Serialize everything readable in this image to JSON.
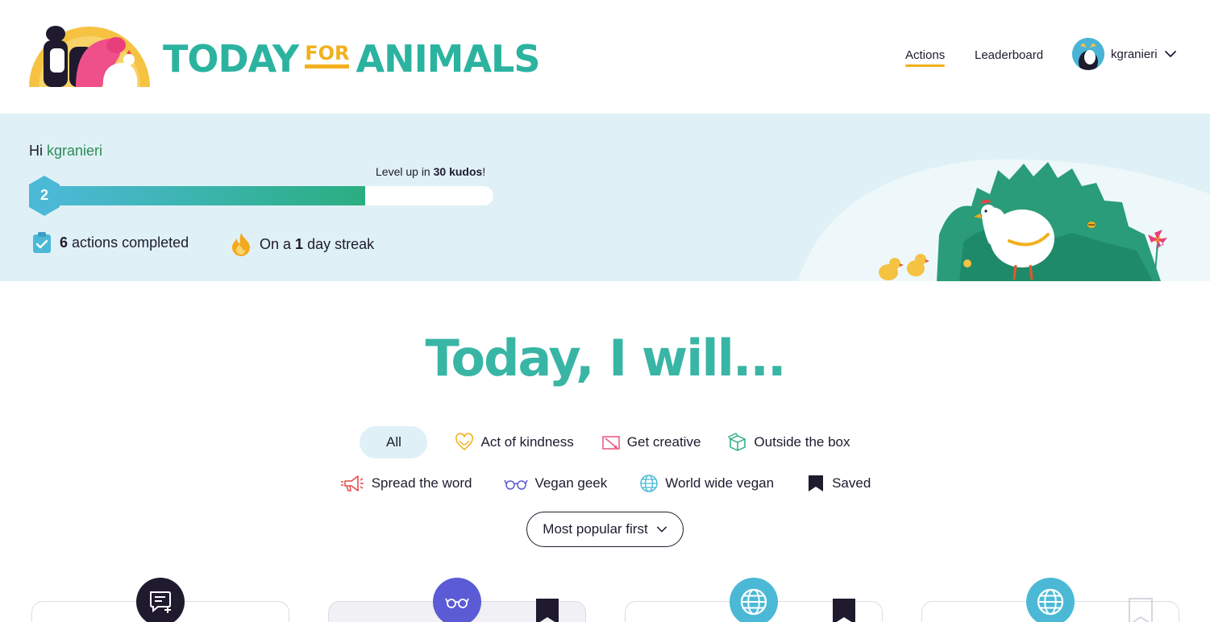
{
  "brand": {
    "word1": "TODAY",
    "word2": "FOR",
    "word3": "ANIMALS",
    "colors": {
      "teal": "#2bb3a0",
      "yellow": "#f2b01e",
      "ink": "#1f1a2e",
      "hero_bg": "#dff1f6"
    }
  },
  "nav": {
    "actions": "Actions",
    "leaderboard": "Leaderboard",
    "username": "kgranieri",
    "avatar_icon": "cow-avatar-icon",
    "menu_icon": "chevron-down-icon"
  },
  "hero": {
    "greeting": "Hi",
    "username": "kgranieri",
    "level": "2",
    "levelup_prefix": "Level up in",
    "levelup_amount": "30 kudos",
    "levelup_suffix": "!",
    "progress_fraction": 0.71,
    "actions_count": "6",
    "actions_label": "actions completed",
    "streak_prefix": "On a",
    "streak_count": "1",
    "streak_suffix": "day streak"
  },
  "main": {
    "headline": "Today, I will...",
    "filters_row1": [
      {
        "label": "All",
        "icon": ""
      },
      {
        "label": "Act of kindness",
        "icon": "heart-icon"
      },
      {
        "label": "Get creative",
        "icon": "pencil-icon"
      },
      {
        "label": "Outside the box",
        "icon": "box-icon"
      }
    ],
    "filters_row2": [
      {
        "label": "Spread the word",
        "icon": "megaphone-icon"
      },
      {
        "label": "Vegan geek",
        "icon": "glasses-icon"
      },
      {
        "label": "World wide vegan",
        "icon": "globe-icon"
      },
      {
        "label": "Saved",
        "icon": "bookmark-icon"
      }
    ],
    "sort_label": "Most popular first"
  },
  "cards": [
    {
      "icon": "chat-add-icon",
      "saved": false
    },
    {
      "icon": "glasses-icon",
      "saved": true
    },
    {
      "icon": "globe-icon",
      "saved": true
    },
    {
      "icon": "globe-icon",
      "saved": false
    }
  ]
}
